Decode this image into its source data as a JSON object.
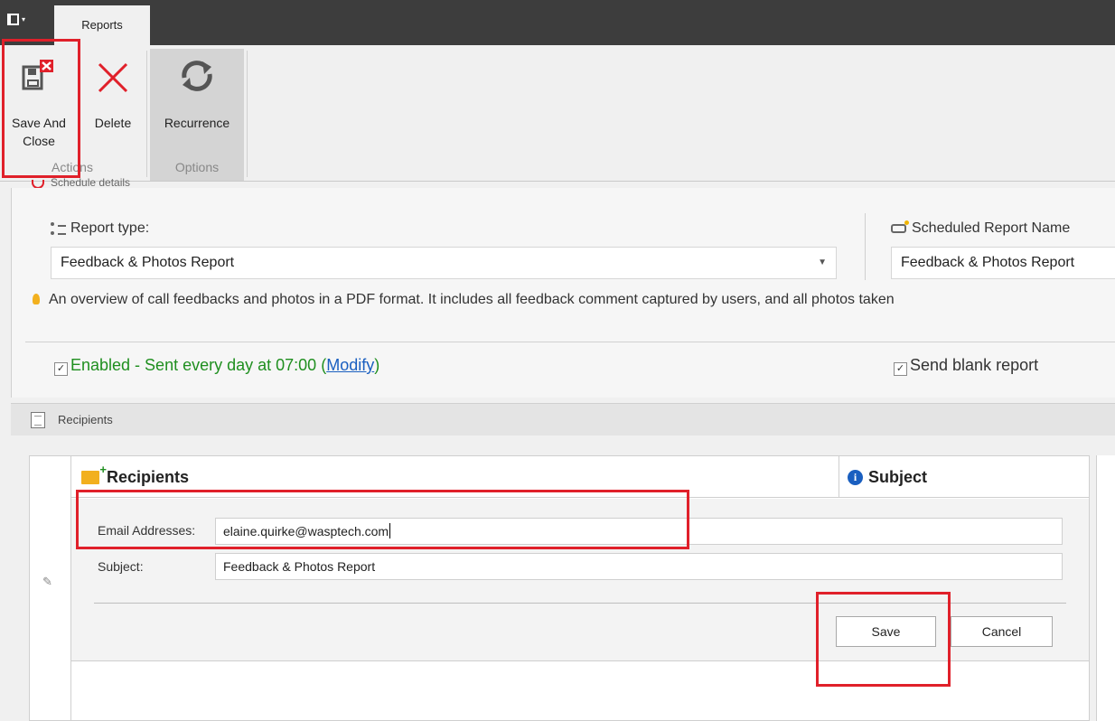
{
  "titlebar": {
    "tab_reports": "Reports"
  },
  "ribbon": {
    "save_and_close": "Save And Close",
    "delete": "Delete",
    "recurrence": "Recurrence",
    "group_actions": "Actions",
    "group_options": "Options"
  },
  "schedule": {
    "section_title": "Schedule details",
    "report_type_label": "Report type:",
    "report_type_value": "Feedback & Photos Report",
    "scheduled_name_label": "Scheduled Report Name",
    "scheduled_name_value": "Feedback & Photos Report",
    "description": "An overview of call feedbacks and photos in a PDF format. It includes all feedback comment captured by users, and all photos taken",
    "enabled_text": "Enabled - Sent every day at 07:00",
    "modify_link": "Modify",
    "send_blank_label": "Send blank report",
    "enabled_checked": true,
    "send_blank_checked": true
  },
  "recipients": {
    "section_title": "Recipients",
    "col_recipients": "Recipients",
    "col_subject": "Subject",
    "email_label": "Email Addresses:",
    "email_value": "elaine.quirke@wasptech.com",
    "subject_label": "Subject:",
    "subject_value": "Feedback & Photos Report",
    "save_button": "Save",
    "cancel_button": "Cancel"
  },
  "colors": {
    "highlight": "#e0202a",
    "enabled_green": "#1f8f1f",
    "link_blue": "#1a5fc0",
    "titlebar": "#3d3d3d"
  }
}
